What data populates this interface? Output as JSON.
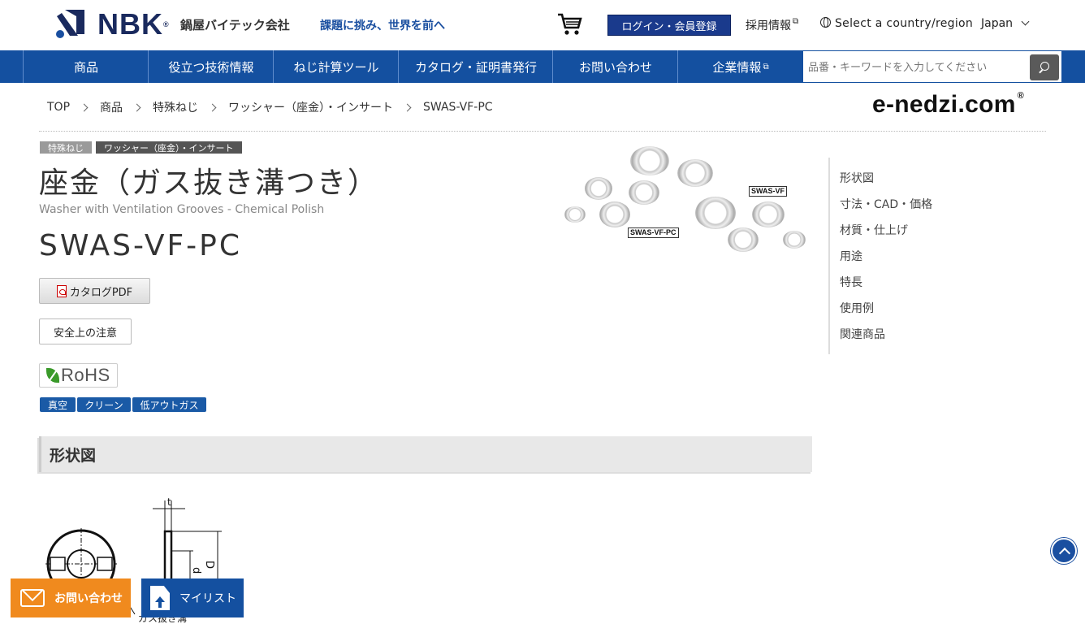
{
  "header": {
    "brand": "NBK",
    "brand_mark": "®",
    "company": "鍋屋バイテック会社",
    "tagline": "課題に挑み、世界を前へ",
    "cart_icon": "cart-icon",
    "login_label": "ログイン・会員登録",
    "recruit_label": "採用情報",
    "region_label": "Select a country/region",
    "country": "Japan"
  },
  "nav": {
    "items": [
      "商品",
      "役立つ技術情報",
      "ねじ計算ツール",
      "カタログ・証明書発行",
      "お問い合わせ",
      "企業情報"
    ],
    "search_placeholder": "品番・キーワードを入力してください"
  },
  "breadcrumb": [
    "TOP",
    "商品",
    "特殊ねじ",
    "ワッシャー（座金）・インサート",
    "SWAS-VF-PC"
  ],
  "site_logo": "e-nedzi.com",
  "site_logo_mark": "®",
  "product": {
    "tags": [
      "特殊ねじ",
      "ワッシャー（座金）・インサート"
    ],
    "title": "座金（ガス抜き溝つき）",
    "subtitle": "Washer with Ventilation Grooves - Chemical Polish",
    "code": "SWAS-VF-PC",
    "catalog_button": "カタログPDF",
    "safety_button": "安全上の注意",
    "rohs": "RoHS",
    "badges": [
      "真空",
      "クリーン",
      "低アウトガス"
    ],
    "photo_labels": [
      "SWAS-VF",
      "SWAS-VF-PC"
    ]
  },
  "sidenav": [
    "形状図",
    "寸法・CAD・価格",
    "材質・仕上げ",
    "用途",
    "特長",
    "使用例",
    "関連商品"
  ],
  "section": {
    "title": "形状図",
    "drawing_labels": [
      "t",
      "d",
      "D"
    ],
    "drawing_caption": "ガス抜き溝"
  },
  "floating": {
    "contact": "お問い合わせ",
    "mylist": "マイリスト"
  },
  "colors": {
    "nav_blue": "#1450a0",
    "brand_navy": "#1a2a5e",
    "contact_orange": "#f08a1e",
    "badge_blue": "#1a5aa6"
  }
}
